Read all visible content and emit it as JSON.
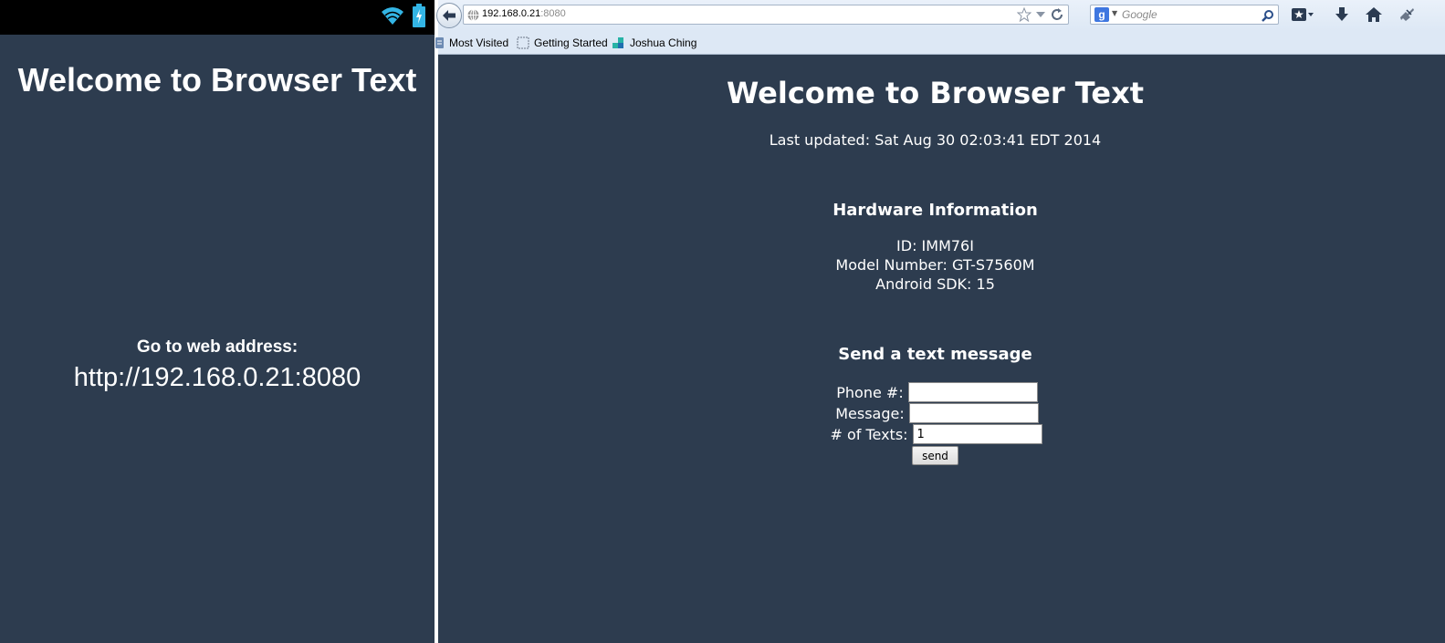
{
  "phone": {
    "status_icons": [
      "wifi-icon",
      "battery-charging-icon"
    ],
    "title": "Welcome to Browser Text",
    "goto_label": "Go to web address:",
    "url": "http://192.168.0.21:8080"
  },
  "browser": {
    "address": {
      "host": "192.168.0.21",
      "port": ":8080"
    },
    "search_placeholder": "Google",
    "bookmarks": [
      "Most Visited",
      "Getting Started",
      "Joshua Ching"
    ]
  },
  "page": {
    "title": "Welcome to Browser Text",
    "last_updated": "Last updated: Sat Aug 30 02:03:41 EDT 2014",
    "hardware": {
      "heading": "Hardware Information",
      "id": "ID: IMM76I",
      "model": "Model Number: GT-S7560M",
      "sdk": "Android SDK: 15"
    },
    "sms": {
      "heading": "Send a text message",
      "phone_label": "Phone #:",
      "phone_value": "",
      "message_label": "Message:",
      "message_value": "",
      "count_label": "# of Texts:",
      "count_value": "1",
      "send_label": "send"
    }
  },
  "colors": {
    "background": "#2d3c4f",
    "text": "#ffffff",
    "status_bar": "#000000",
    "icon_accent": "#33b5e5"
  }
}
